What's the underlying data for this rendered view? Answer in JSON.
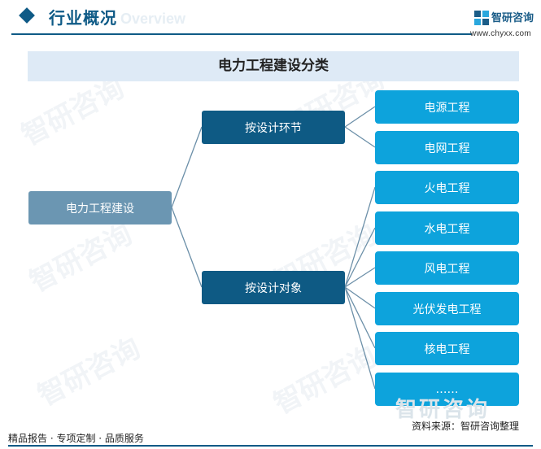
{
  "header": {
    "section_title": "行业概况",
    "section_title_en": "Overview",
    "logo_name": "智研咨询",
    "logo_url": "www.chyxx.com"
  },
  "diagram": {
    "title": "电力工程建设分类",
    "root": "电力工程建设",
    "branches": [
      {
        "label": "按设计环节",
        "children": [
          "电源工程",
          "电网工程"
        ]
      },
      {
        "label": "按设计对象",
        "children": [
          "火电工程",
          "水电工程",
          "风电工程",
          "光伏发电工程",
          "核电工程",
          "……"
        ]
      }
    ]
  },
  "watermark": {
    "text": "智研咨询",
    "footer_text": "智研咨询"
  },
  "footer": {
    "services": "精品报告 · 专项定制 · 品质服务",
    "source": "资料来源：智研咨询整理"
  },
  "colors": {
    "brand_dark": "#0e5a84",
    "root_node": "#6b96b2",
    "leaf_node": "#0da3dc",
    "title_band": "#deeaf6",
    "connector": "#6b8fa8"
  }
}
